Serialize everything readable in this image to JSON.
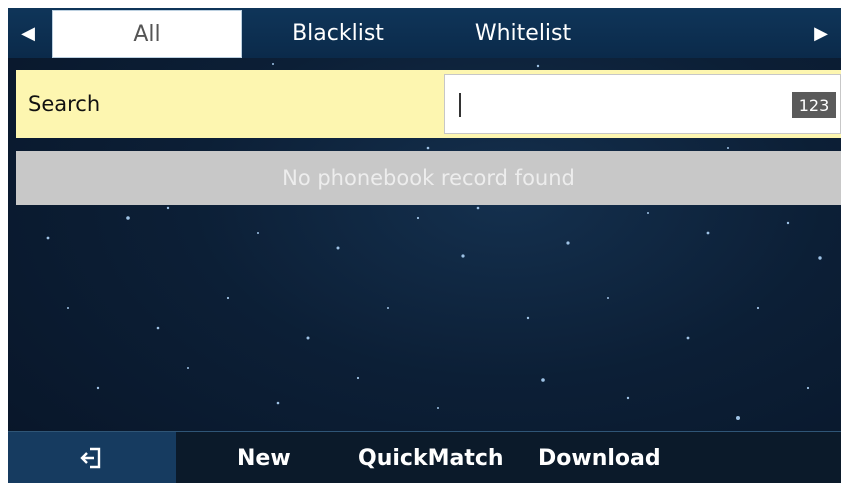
{
  "tabs": {
    "left_arrow_icon": "triangle-left-icon",
    "right_arrow_icon": "triangle-right-icon",
    "items": [
      {
        "label": "All",
        "active": true
      },
      {
        "label": "Blacklist",
        "active": false
      },
      {
        "label": "Whitelist",
        "active": false
      }
    ]
  },
  "search": {
    "label": "Search",
    "value": "",
    "input_mode": "123"
  },
  "list": {
    "empty_message": "No phonebook record found"
  },
  "softkeys": {
    "back_icon": "exit-icon",
    "items": [
      "New",
      "QuickMatch",
      "Download"
    ]
  },
  "colors": {
    "tabbar": "#0f3559",
    "search_row": "#fdf6b0",
    "empty_row": "#c8c8c8",
    "softkey_back": "#163b60"
  }
}
